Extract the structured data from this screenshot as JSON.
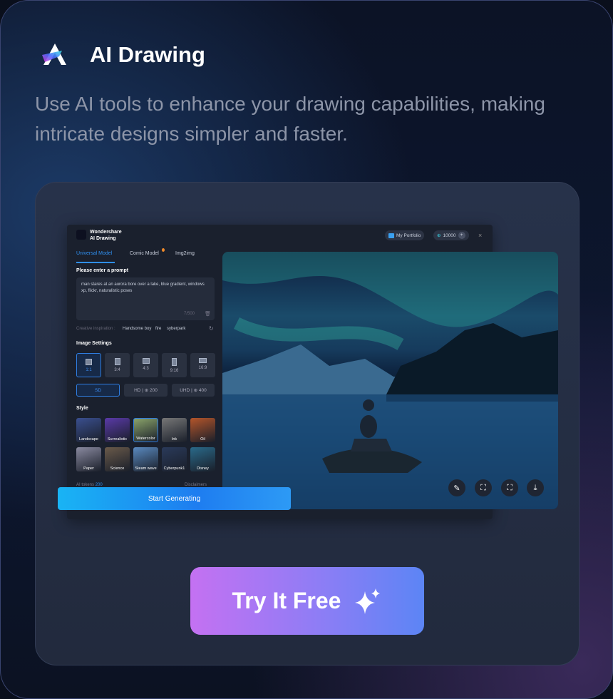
{
  "header": {
    "title": "AI Drawing",
    "subtitle": "Use AI tools to enhance your drawing capabilities, making intricate designs simpler and faster."
  },
  "app": {
    "brand_line1": "Wondershare",
    "brand_line2": "AI Drawing",
    "portfolio": "My Portfolio",
    "credits": "10000",
    "tabs": [
      {
        "label": "Universal Model",
        "active": true
      },
      {
        "label": "Comic Model"
      },
      {
        "label": "Img2img"
      }
    ],
    "prompt_label": "Please enter a prompt",
    "prompt_text": "man stares at an aurora bore over a lake,  blue gradient, windows xp, flickr, naturalistic poses",
    "char_count": "7/500",
    "inspiration_label": "Creative inspiration :",
    "inspirations": [
      "Handsome boy",
      "fire",
      "syberpark"
    ],
    "image_settings_label": "Image Settings",
    "ratios": [
      "1:1",
      "3:4",
      "4:3",
      "9:16",
      "16:9"
    ],
    "resolutions": [
      {
        "label": "SD"
      },
      {
        "label": "HD",
        "cost": "200"
      },
      {
        "label": "UHD",
        "cost": "400"
      }
    ],
    "style_label": "Style",
    "styles": [
      {
        "label": "Landscape",
        "color": "#3a4f8f"
      },
      {
        "label": "Surrealistic",
        "color": "#5a3aa8"
      },
      {
        "label": "Watercolor",
        "color": "#8aa36a",
        "selected": true
      },
      {
        "label": "Ink",
        "color": "#777"
      },
      {
        "label": "Oil",
        "color": "#b4552a"
      },
      {
        "label": "Paper",
        "color": "#8a8aa0"
      },
      {
        "label": "Science",
        "color": "#6a5a4a"
      },
      {
        "label": "Steam wave",
        "color": "#5a8ac0"
      },
      {
        "label": "Cyberpunk1",
        "color": "#2a3a5a"
      },
      {
        "label": "Disney",
        "color": "#2a6a8a"
      }
    ],
    "tokens_label": "AI tokens",
    "tokens_value": "200",
    "disclaimers": "Disclaimers",
    "generate": "Start Generating"
  },
  "cta": "Try It Free",
  "colors": {
    "accent": "#2f7de0",
    "cta_start": "#c471f2",
    "cta_end": "#5c85f5"
  }
}
